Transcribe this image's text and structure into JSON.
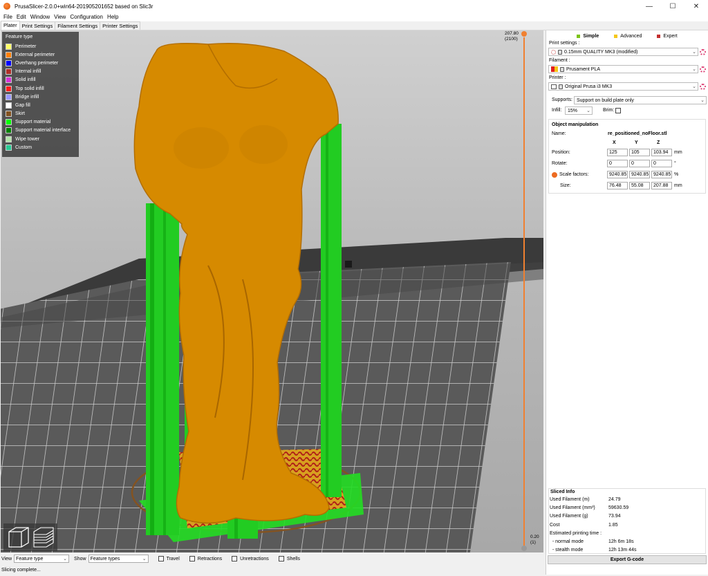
{
  "window": {
    "title": "PrusaSlicer-2.0.0+win64-201905201652 based on Slic3r"
  },
  "menu": [
    "File",
    "Edit",
    "Window",
    "View",
    "Configuration",
    "Help"
  ],
  "tabs": [
    "Plater",
    "Print Settings",
    "Filament Settings",
    "Printer Settings"
  ],
  "legend": {
    "title": "Feature type",
    "items": [
      {
        "label": "Perimeter",
        "color": "#ffff66"
      },
      {
        "label": "External perimeter",
        "color": "#ff7f00"
      },
      {
        "label": "Overhang perimeter",
        "color": "#0000ff"
      },
      {
        "label": "Internal infill",
        "color": "#b03029"
      },
      {
        "label": "Solid infill",
        "color": "#d732d7"
      },
      {
        "label": "Top solid infill",
        "color": "#ff1a1a"
      },
      {
        "label": "Bridge infill",
        "color": "#9999ff"
      },
      {
        "label": "Gap fill",
        "color": "#ffffff"
      },
      {
        "label": "Skirt",
        "color": "#845321"
      },
      {
        "label": "Support material",
        "color": "#00ff00"
      },
      {
        "label": "Support material interface",
        "color": "#008000"
      },
      {
        "label": "Wipe tower",
        "color": "#b3e3ab"
      },
      {
        "label": "Custom",
        "color": "#28cc94"
      }
    ]
  },
  "layer_slider": {
    "top_height": "207.80",
    "top_layer": "(2100)",
    "bottom_height": "0.20",
    "bottom_layer": "(1)"
  },
  "modes": [
    {
      "label": "Simple",
      "color": "#7cc319"
    },
    {
      "label": "Advanced",
      "color": "#f5c71a"
    },
    {
      "label": "Expert",
      "color": "#c32f2f"
    }
  ],
  "print_settings": {
    "label": "Print settings :",
    "value": "0.15mm QUALITY MK3 (modified)"
  },
  "filament": {
    "label": "Filament :",
    "value": "Prusament PLA"
  },
  "printer": {
    "label": "Printer :",
    "value": "Original Prusa i3 MK3"
  },
  "supports": {
    "label": "Supports:",
    "value": "Support on build plate only"
  },
  "infill": {
    "label": "Infill:",
    "value": "15%"
  },
  "brim": {
    "label": "Brim:"
  },
  "object_manipulation": {
    "title": "Object manipulation",
    "name_label": "Name:",
    "name": "re_positioned_noFloor.stl",
    "headers": [
      "X",
      "Y",
      "Z"
    ],
    "position": {
      "label": "Position:",
      "values": [
        "125",
        "105",
        "103.94"
      ],
      "unit": "mm"
    },
    "rotate": {
      "label": "Rotate:",
      "values": [
        "0",
        "0",
        "0"
      ],
      "unit": "°"
    },
    "scale": {
      "label": "Scale factors:",
      "values": [
        "9240.85",
        "9240.85",
        "9240.85"
      ],
      "unit": "%"
    },
    "size": {
      "label": "Size:",
      "values": [
        "76.48",
        "55.08",
        "207.88"
      ],
      "unit": "mm"
    }
  },
  "sliced_info": {
    "title": "Sliced Info",
    "rows": [
      {
        "key": "Used Filament (m)",
        "value": "24.79"
      },
      {
        "key": "Used Filament (mm³)",
        "value": "59630.59"
      },
      {
        "key": "Used Filament (g)",
        "value": "73.94"
      },
      {
        "key": "Cost",
        "value": "1.85"
      },
      {
        "key": "Estimated printing time :",
        "value": ""
      },
      {
        "key": "  - normal mode",
        "value": "12h 6m 18s"
      },
      {
        "key": "  - stealth mode",
        "value": "12h 13m 44s"
      }
    ]
  },
  "export_button": "Export G-code",
  "bottom": {
    "view_label": "View",
    "view_value": "Feature type",
    "show_label": "Show",
    "show_value": "Feature types",
    "checkboxes": [
      "Travel",
      "Retractions",
      "Unretractions",
      "Shells"
    ]
  },
  "status": "Slicing complete..."
}
